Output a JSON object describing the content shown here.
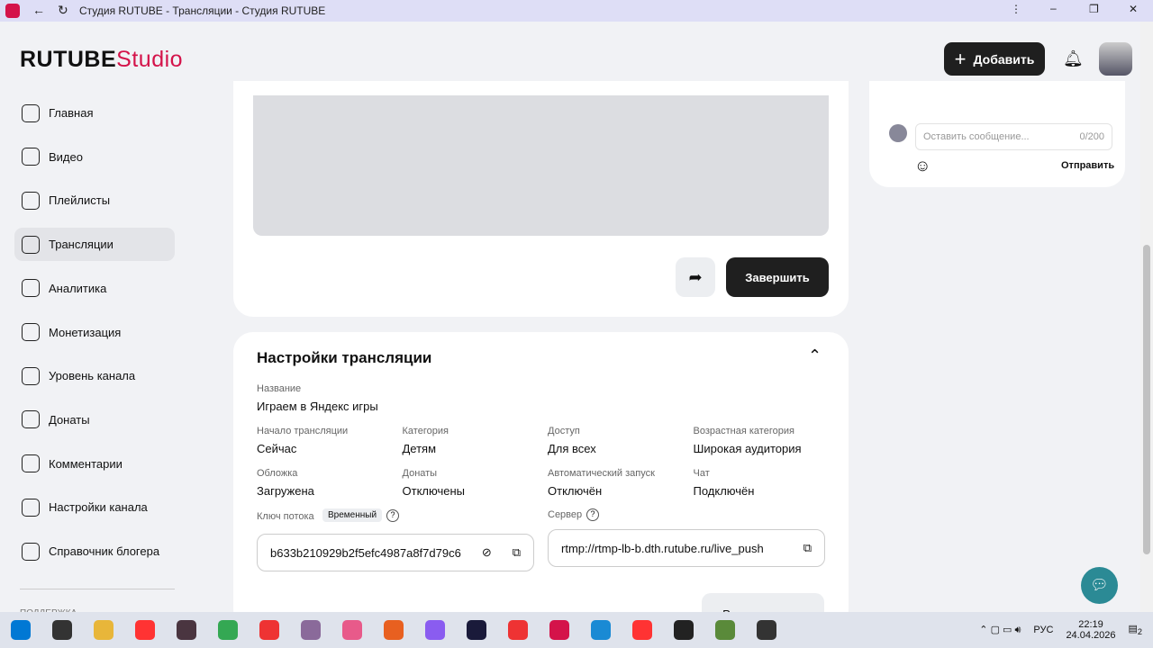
{
  "browser": {
    "title": "Студия RUTUBE - Трансляции - Студия RUTUBE"
  },
  "header": {
    "logo_main": "RUTUBE",
    "logo_accent": "Studio",
    "add_label": "Добавить"
  },
  "sidebar": {
    "items": [
      {
        "label": "Главная"
      },
      {
        "label": "Видео"
      },
      {
        "label": "Плейлисты"
      },
      {
        "label": "Трансляции",
        "active": true
      },
      {
        "label": "Аналитика"
      },
      {
        "label": "Монетизация"
      },
      {
        "label": "Уровень канала"
      },
      {
        "label": "Донаты"
      },
      {
        "label": "Комментарии"
      },
      {
        "label": "Настройки канала"
      },
      {
        "label": "Справочник блогера"
      }
    ],
    "section": "ПОДДЕРЖКА"
  },
  "player": {
    "finish_label": "Завершить"
  },
  "chat": {
    "placeholder": "Оставить сообщение...",
    "counter": "0/200",
    "send_label": "Отправить"
  },
  "settings": {
    "title": "Настройки трансляции",
    "name_label": "Название",
    "name_value": "Играем в Яндекс игры",
    "fields": [
      {
        "label": "Начало трансляции",
        "value": "Сейчас"
      },
      {
        "label": "Категория",
        "value": "Детям"
      },
      {
        "label": "Доступ",
        "value": "Для всех"
      },
      {
        "label": "Возрастная категория",
        "value": "Широкая аудитория"
      },
      {
        "label": "Обложка",
        "value": "Загружена"
      },
      {
        "label": "Донаты",
        "value": "Отключены"
      },
      {
        "label": "Автоматический запуск",
        "value": "Отключён"
      },
      {
        "label": "Чат",
        "value": "Подключён"
      }
    ],
    "key_label": "Ключ потока",
    "key_badge": "Временный",
    "key_value": "b633b210929b2f5efc4987a8f7d79c6",
    "server_label": "Сервер",
    "server_value": "rtmp://rtmp-lb-b.dth.rutube.ru/live_push",
    "edit_label": "Редактировать"
  },
  "taskbar": {
    "lang": "РУС",
    "time": "22:19",
    "date": "24.04.2026",
    "notifications": "2"
  }
}
